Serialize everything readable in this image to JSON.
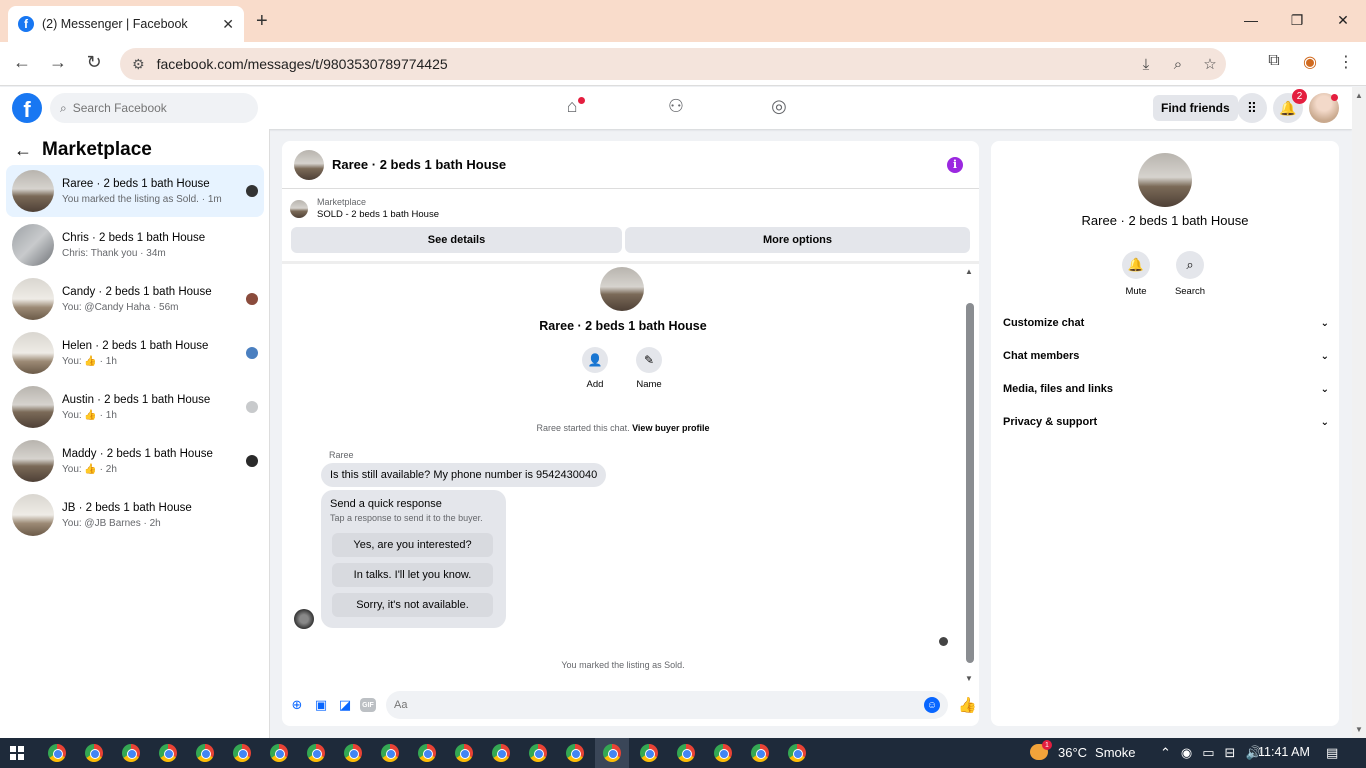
{
  "browser": {
    "tab_title": "(2) Messenger | Facebook",
    "tab_close": "✕",
    "new_tab": "+",
    "url": "facebook.com/messages/t/9803530789774425"
  },
  "fb": {
    "search_placeholder": "Search Facebook",
    "find_friends": "Find friends",
    "notif_count": "2"
  },
  "sidebar": {
    "title": "Marketplace",
    "conversations": [
      {
        "name": "Raree · 2 beds 1 bath House",
        "sub": "You marked the listing as Sold. · 1m"
      },
      {
        "name": "Chris · 2 beds 1 bath House",
        "sub": "Chris: Thank you · 34m"
      },
      {
        "name": "Candy · 2 beds 1 bath House",
        "sub": "You: @Candy Haha · 56m"
      },
      {
        "name": "Helen · 2 beds 1 bath House",
        "sub": "You: 👍 · 1h"
      },
      {
        "name": "Austin · 2 beds 1 bath House",
        "sub": "You: 👍 · 1h"
      },
      {
        "name": "Maddy · 2 beds 1 bath House",
        "sub": "You: 👍 · 2h"
      },
      {
        "name": "JB · 2 beds 1 bath House",
        "sub": "You: @JB Barnes · 2h"
      }
    ]
  },
  "chat": {
    "title": "Raree · 2 beds 1 bath House",
    "marketplace_label": "Marketplace",
    "listing_status": "SOLD - 2 beds 1 bath House",
    "see_details": "See details",
    "more_options": "More options",
    "profile_name": "Raree · 2 beds 1 bath House",
    "add_label": "Add",
    "name_label": "Name",
    "started_text": "Raree started this chat.",
    "view_buyer": "View buyer profile",
    "sender": "Raree",
    "message": "Is this still available? My phone number is 9542430040",
    "quick_title": "Send a quick response",
    "quick_sub": "Tap a response to send it to the buyer.",
    "quick_options": [
      "Yes, are you interested?",
      "In talks. I'll let you know.",
      "Sorry, it's not available."
    ],
    "sold_notice": "You marked the listing as Sold.",
    "composer_placeholder": "Aa",
    "gif_label": "GIF"
  },
  "right_panel": {
    "name": "Raree · 2 beds 1 bath House",
    "mute": "Mute",
    "search": "Search",
    "sections": [
      "Customize chat",
      "Chat members",
      "Media, files and links",
      "Privacy & support"
    ]
  },
  "taskbar": {
    "weather_badge": "1",
    "temperature": "36°C",
    "weather": "Smoke",
    "time": "11:41 AM"
  },
  "colors": {
    "fb_blue": "#1877f2",
    "messenger_blue": "#0866ff",
    "info_purple": "#9b28e0",
    "badge_red": "#e41e3f"
  }
}
